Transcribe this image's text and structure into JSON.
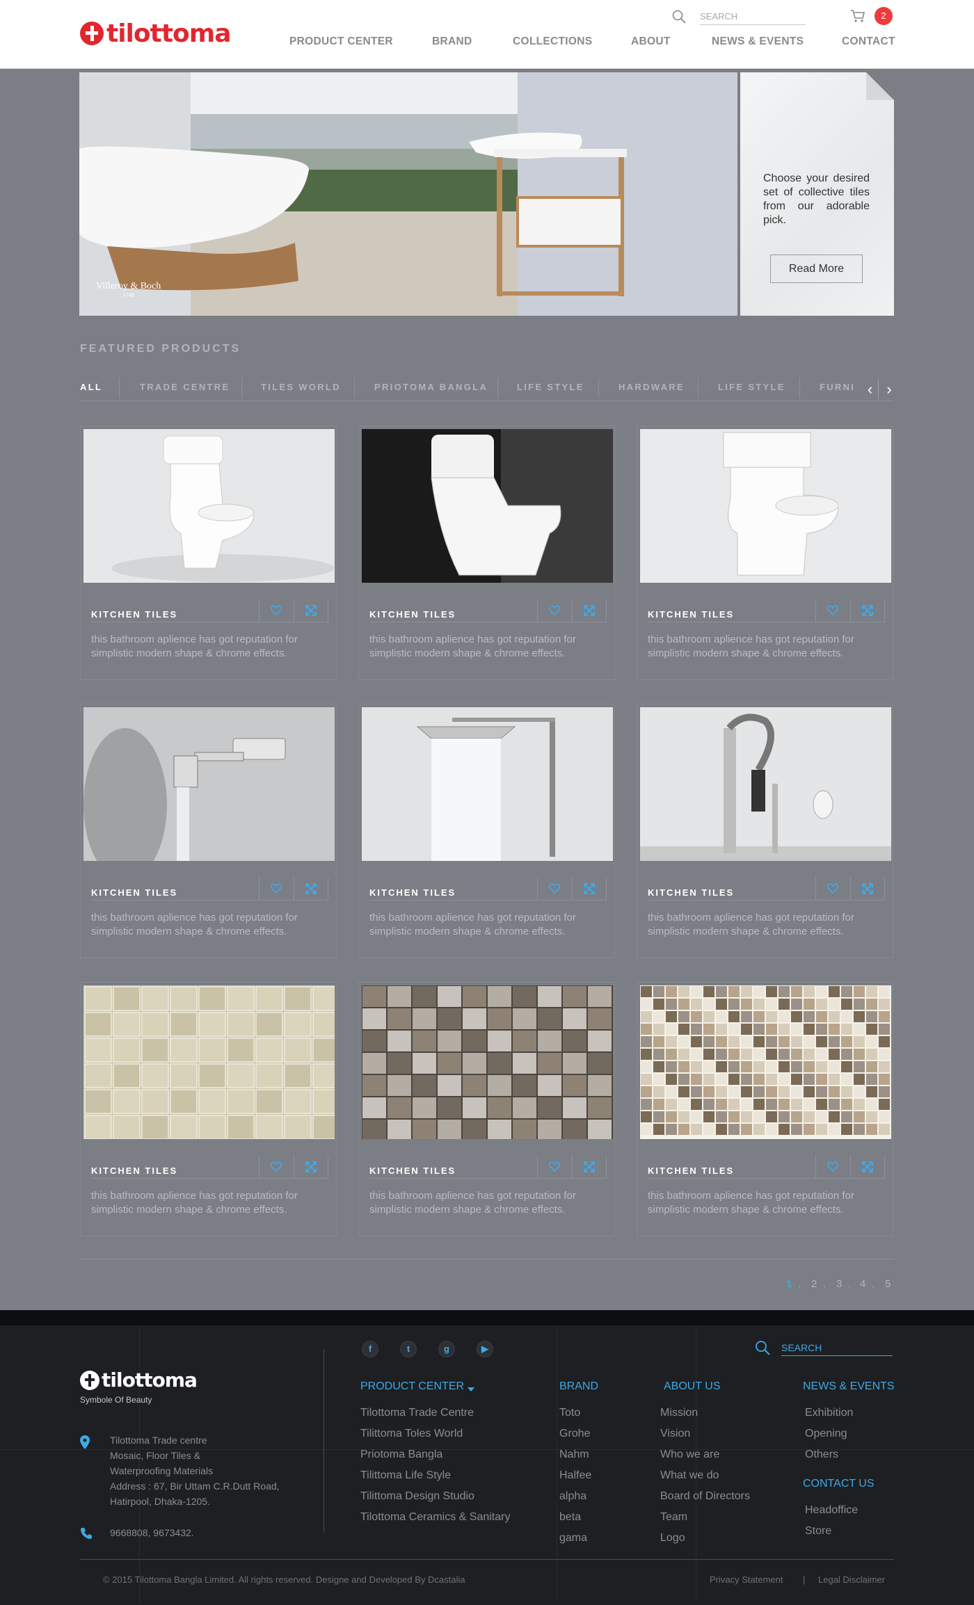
{
  "header": {
    "logo": "tilottoma",
    "search_placeholder": "SEARCH",
    "cart_count": "2",
    "nav": [
      "PRODUCT CENTER",
      "BRAND",
      "COLLECTIONS",
      "ABOUT",
      "NEWS & EVENTS",
      "CONTACT"
    ]
  },
  "hero": {
    "brand_logo": "Villeroy & Boch",
    "brand_year": "1748",
    "card_text": "Choose your desired set of collective tiles from our adorable pick.",
    "button": "Read More"
  },
  "featured": {
    "title": "FEATURED PRODUCTS",
    "filters": [
      "ALL",
      "TRADE CENTRE",
      "TILES WORLD",
      "PRIOTOMA BANGLA",
      "LIFE STYLE",
      "HARDWARE",
      "LIFE STYLE",
      "FURNI"
    ],
    "products": [
      {
        "title": "KITCHEN TILES",
        "desc": "this bathroom aplience has got reputation for simplistic modern shape & chrome effects.",
        "image": "toilet-white"
      },
      {
        "title": "KITCHEN TILES",
        "desc": "this bathroom aplience has got reputation for simplistic modern shape & chrome effects.",
        "image": "toilet-dark"
      },
      {
        "title": "KITCHEN TILES",
        "desc": "this bathroom aplience has got reputation for simplistic modern shape & chrome effects.",
        "image": "toilet-square"
      },
      {
        "title": "KITCHEN TILES",
        "desc": "this bathroom aplience has got reputation for simplistic modern shape & chrome effects.",
        "image": "wall-faucet"
      },
      {
        "title": "KITCHEN TILES",
        "desc": "this bathroom aplience has got reputation for simplistic modern shape & chrome effects.",
        "image": "rain-shower"
      },
      {
        "title": "KITCHEN TILES",
        "desc": "this bathroom aplience has got reputation for simplistic modern shape & chrome effects.",
        "image": "kitchen-faucet"
      },
      {
        "title": "KITCHEN TILES",
        "desc": "this bathroom aplience has got reputation for simplistic modern shape & chrome effects.",
        "image": "beige-tiles"
      },
      {
        "title": "KITCHEN TILES",
        "desc": "this bathroom aplience has got reputation for simplistic modern shape & chrome effects.",
        "image": "stone-tiles"
      },
      {
        "title": "KITCHEN TILES",
        "desc": "this bathroom aplience has got reputation for simplistic modern shape & chrome effects.",
        "image": "mosaic-tiles"
      }
    ]
  },
  "pagination": {
    "pages": [
      "1",
      "2",
      "3",
      "4",
      "5"
    ],
    "current": "1"
  },
  "footer": {
    "logo": "tilottoma",
    "tagline": "Symbole Of Beauty",
    "address": [
      "Tilottoma Trade centre",
      "Mosaic, Floor Tiles &",
      "Waterproofing Materials",
      "Address : 67, Bir Uttam C.R.Dutt Road,",
      "Hatirpool, Dhaka-1205."
    ],
    "phone": "9668808, 9673432.",
    "social": [
      "facebook",
      "twitter",
      "google-plus",
      "youtube"
    ],
    "search_placeholder": "SEARCH",
    "product_center": {
      "heading": "PRODUCT CENTER",
      "items": [
        "Tilottoma Trade Centre",
        "Tilittoma Toles World",
        "Priotoma Bangla",
        "Tilittoma Life Style",
        "Tilittoma Design Studio",
        "Tilottoma Ceramics & Sanitary"
      ]
    },
    "brand": {
      "heading": "BRAND",
      "items": [
        "Toto",
        "Grohe",
        "Nahm",
        "Halfee",
        "alpha",
        "beta",
        "gama"
      ]
    },
    "about": {
      "heading": "ABOUT US",
      "items": [
        "Mission",
        "Vision",
        "Who we are",
        "What we do",
        "Board of Directors",
        "Team",
        "Logo"
      ]
    },
    "news": {
      "heading": "NEWS & EVENTS",
      "items": [
        "Exhibition",
        "Opening",
        "Others"
      ]
    },
    "contact": {
      "heading": "CONTACT US",
      "items": [
        "Headoffice",
        "Store"
      ]
    },
    "copyright": "© 2015 Tilottoma Bangla Limited. All rights reserved. Designe and Developed By Dcastalia",
    "privacy": "Privacy Statement",
    "separator": "|",
    "legal": "Legal Disclaimer"
  },
  "colors": {
    "brand_red": "#e2262f",
    "accent_blue": "#3ea9e6",
    "page_bg": "#7b7e85",
    "footer_bg": "#1d1f22"
  }
}
